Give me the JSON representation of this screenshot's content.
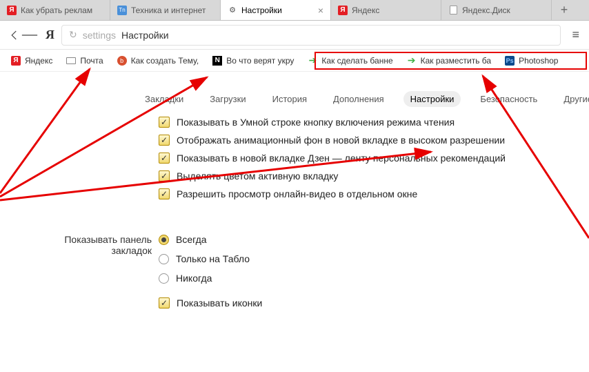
{
  "tabs": [
    {
      "label": "Как убрать реклам",
      "icon": "Я",
      "iconType": "y-red"
    },
    {
      "label": "Техника и интернет",
      "icon": "Tn",
      "iconType": "tn"
    },
    {
      "label": "Настройки",
      "icon": "⚙",
      "iconType": "gear",
      "active": true
    },
    {
      "label": "Яндекс",
      "icon": "Я",
      "iconType": "y-red"
    },
    {
      "label": "Яндекс.Диск",
      "icon": "",
      "iconType": "doc"
    }
  ],
  "address": {
    "prefix": "settings",
    "text": "Настройки"
  },
  "bookmarks": [
    {
      "label": "Яндекс",
      "iconType": "y-red",
      "icon": "Я"
    },
    {
      "label": "Почта",
      "iconType": "mail",
      "icon": ""
    },
    {
      "label": "Как создать Тему,",
      "iconType": "blog",
      "icon": "b"
    },
    {
      "label": "Во что верят укру",
      "iconType": "n",
      "icon": "N"
    },
    {
      "label": "Как сделать банне",
      "iconType": "arrow-green",
      "icon": "➔"
    },
    {
      "label": "Как разместить ба",
      "iconType": "arrow-green",
      "icon": "➔"
    },
    {
      "label": "Photoshop",
      "iconType": "ps",
      "icon": "Ps"
    }
  ],
  "settingsTabs": [
    "Закладки",
    "Загрузки",
    "История",
    "Дополнения",
    "Настройки",
    "Безопасность",
    "Другие устрой"
  ],
  "activeSettingsTab": 4,
  "checkboxes": [
    "Показывать в Умной строке кнопку включения режима чтения",
    "Отображать анимационный фон в новой вкладке в высоком разрешении",
    "Показывать в новой вкладке Дзен — ленту персональных рекомендаций",
    "Выделять цветом активную вкладку",
    "Разрешить просмотр онлайн-видео в отдельном окне"
  ],
  "bookmarkPanel": {
    "label": "Показывать панель закладок",
    "options": [
      "Всегда",
      "Только на Табло",
      "Никогда"
    ],
    "selected": 0,
    "showIcons": "Показывать иконки"
  }
}
